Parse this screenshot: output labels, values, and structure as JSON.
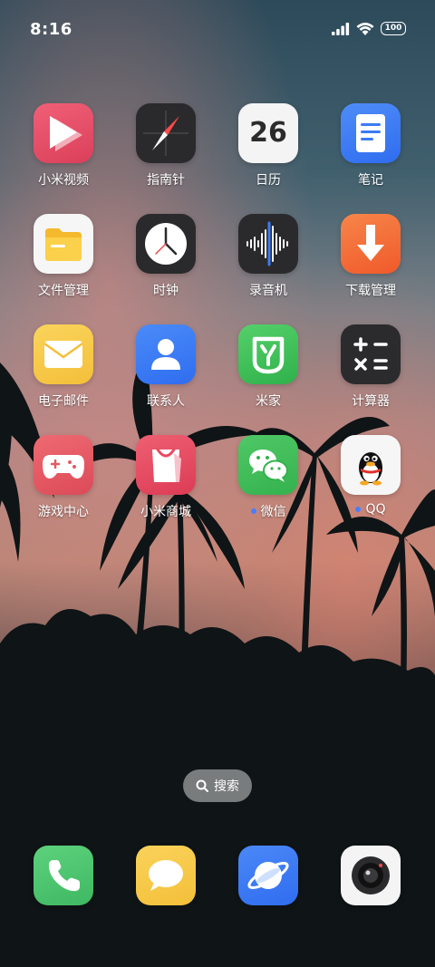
{
  "status_bar": {
    "time": "8:16",
    "battery": "100"
  },
  "apps": [
    {
      "label": "小米视频",
      "icon": "video-play-icon"
    },
    {
      "label": "指南针",
      "icon": "compass-icon"
    },
    {
      "label": "日历",
      "icon": "calendar-icon",
      "date": "26"
    },
    {
      "label": "笔记",
      "icon": "notes-icon"
    },
    {
      "label": "文件管理",
      "icon": "folder-icon"
    },
    {
      "label": "时钟",
      "icon": "clock-icon"
    },
    {
      "label": "录音机",
      "icon": "recorder-waveform-icon"
    },
    {
      "label": "下载管理",
      "icon": "download-arrow-icon"
    },
    {
      "label": "电子邮件",
      "icon": "mail-envelope-icon"
    },
    {
      "label": "联系人",
      "icon": "contacts-person-icon"
    },
    {
      "label": "米家",
      "icon": "mijia-icon"
    },
    {
      "label": "计算器",
      "icon": "calculator-icon"
    },
    {
      "label": "游戏中心",
      "icon": "gamepad-icon"
    },
    {
      "label": "小米商城",
      "icon": "shopping-bag-icon"
    },
    {
      "label": "微信",
      "icon": "wechat-icon",
      "notification_dot": true
    },
    {
      "label": "QQ",
      "icon": "qq-penguin-icon",
      "notification_dot": true
    }
  ],
  "search": {
    "label": "搜索"
  },
  "dock": [
    {
      "icon": "phone-icon"
    },
    {
      "icon": "messages-icon"
    },
    {
      "icon": "browser-icon"
    },
    {
      "icon": "camera-icon"
    }
  ],
  "colors": {
    "video": "#e8546c",
    "compass": "#2a2a2c",
    "notes": "#3b7bf6",
    "download": "#f46a33",
    "mail": "#f7c94a",
    "contacts": "#3a7cf5",
    "mijia": "#3fbf55",
    "calculator": "#2b2b2d",
    "game": "#e45a64",
    "mall": "#e84a5f",
    "wechat": "#3fbf55",
    "phone": "#4fc46e",
    "messages": "#f8c94a",
    "browser": "#3b7bf6"
  }
}
